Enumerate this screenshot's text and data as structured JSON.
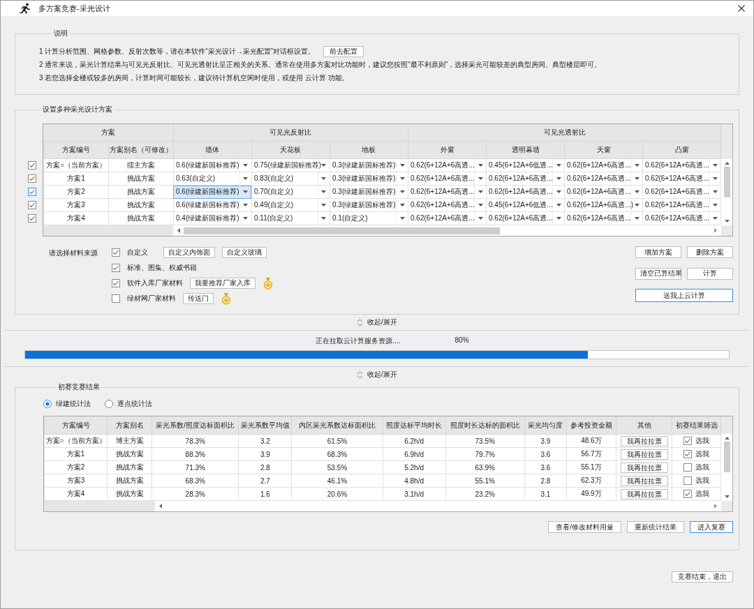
{
  "window": {
    "title": "多方案竞赛-采光设计"
  },
  "notes": {
    "title": "说明",
    "lines": [
      {
        "text": "1 计算分析范围、网格参数、反射次数等，请在本软件“采光设计→采光配置”对话框设置。",
        "button": "前去配置"
      },
      {
        "text": "2 通常来说，采光计算结果与可见光反射比、可见光透射比呈正相关的关系。通常在使用多方案对比功能时，建议您按照“最不利原则”，选择采光可能较差的典型房间、典型楼层即可。"
      },
      {
        "text": "3 若您选择全楼或较多的房间，计算时间可能较长，建议待计算机空闲时使用，或使用 云计算 功能。"
      }
    ]
  },
  "schemes": {
    "title": "设置多种采光设计方案",
    "groups": [
      {
        "label": "方案",
        "columns": [
          "方案编号",
          "方案别名（可修改）"
        ]
      },
      {
        "label": "可见光反射比",
        "columns": [
          "墙体",
          "天花板",
          "地板"
        ]
      },
      {
        "label": "可见光透射比",
        "columns": [
          "外窗",
          "透明幕墙",
          "天窗",
          "凸窗"
        ]
      }
    ],
    "rows": [
      {
        "checked": true,
        "selected": false,
        "number": "方案○（当前方案）",
        "alias": "擂主方案",
        "values": [
          "0.6(绿建新国标推荐)",
          "0.75(绿建新国标推荐)",
          "0.3(绿建新国标推荐)",
          "0.62(6+12A+6高透...",
          "0.45(6+12A+6低透...",
          "0.62(6+12A+6高透...",
          "0.62(6+12A+6高透..."
        ]
      },
      {
        "checked": true,
        "selected": false,
        "number": "方案1",
        "alias": "挑战方案",
        "values": [
          "0.63(自定义)",
          "0.83(自定义)",
          "0.3(绿建新国标推荐)",
          "0.62(6+12A+6高透...",
          "0.62(6+12A+6高透...",
          "0.62(6+12A+6高透...",
          "0.62(6+12A+6高透..."
        ]
      },
      {
        "checked": true,
        "selected": true,
        "number": "方案2",
        "alias": "挑战方案",
        "values": [
          "0.6(绿建新国标推荐)",
          "0.70(自定义)",
          "0.3(绿建新国标推荐)",
          "0.62(6+12A+6高透...",
          "0.62(6+12A+6高透...",
          "0.62(6+12A+6高透...",
          "0.62(6+12A+6高透..."
        ]
      },
      {
        "checked": true,
        "selected": false,
        "number": "方案3",
        "alias": "挑战方案",
        "values": [
          "0.6(绿建新国标推荐)",
          "0.49(自定义)",
          "0.3(绿建新国标推荐)",
          "0.62(6+12A+6高透...",
          "0.45(6+12A+6低透...",
          "0.62(6+12A+6高透...)",
          "0.62(6+12A+6高透..."
        ]
      },
      {
        "checked": true,
        "selected": false,
        "number": "方案4",
        "alias": "挑战方案",
        "values": [
          "0.4(绿建新国标推荐)",
          "0.11(自定义)",
          "0.1(自定义)",
          "0.62(6+12A+6高透...",
          "0.62(6+12A+6高透...",
          "0.62(6+12A+6高透...",
          "0.62(6+12A+6高透..."
        ]
      }
    ]
  },
  "materials": {
    "label": "请选择材料来源",
    "sources": [
      {
        "label": "自定义",
        "checked": true,
        "controls": [
          {
            "kind": "button",
            "label": "自定义内饰面"
          },
          {
            "kind": "button",
            "label": "自定义玻璃"
          }
        ]
      },
      {
        "label": "标准、图集、权威书籍",
        "checked": true
      },
      {
        "label": "软件入库厂家材料",
        "checked": true,
        "controls": [
          {
            "kind": "button",
            "label": "我要推荐厂家入库"
          },
          {
            "kind": "icon"
          }
        ]
      },
      {
        "label": "绿材网厂家材料",
        "checked": false,
        "controls": [
          {
            "kind": "button",
            "label": "传送门"
          },
          {
            "kind": "icon"
          }
        ]
      }
    ]
  },
  "actions": [
    {
      "label": "增加方案",
      "primary": false
    },
    {
      "label": "删除方案",
      "primary": false
    },
    {
      "label": "清空已算结果",
      "primary": false
    },
    {
      "label": "计算",
      "primary": false
    },
    {
      "label": "送我上云计算",
      "primary": true
    }
  ],
  "toggle_top": "收起/展开",
  "progress": {
    "label": "正在拉取云计算服务资源....",
    "percent": "80%",
    "level": 0.8
  },
  "toggle_bottom": "收起/展开",
  "results": {
    "title": "初赛竞赛结果",
    "methods": [
      {
        "label": "绿建统计法",
        "selected": true
      },
      {
        "label": "逐点统计法",
        "selected": false
      }
    ],
    "columns": [
      "方案编号",
      "方案别名",
      "采光系数/照度达标面积比",
      "采光系数平均值",
      "内区采光系数达标面积比",
      "照度达标平均时长",
      "照度时长达标的面积比",
      "采光均匀度",
      "参考投资金额",
      "其他",
      "初赛结果筛选"
    ],
    "rows": [
      {
        "number": "方案○（当前方案）",
        "alias": "博主方案",
        "values": [
          "78.3%",
          "3.2",
          "61.5%",
          "6.2h/d",
          "73.5%",
          "3.9",
          "48.6万"
        ],
        "vote_button": "我再拉拉票",
        "pick": {
          "label": "选我",
          "checked": true
        }
      },
      {
        "number": "方案1",
        "alias": "挑战方案",
        "values": [
          "88.3%",
          "3.9",
          "68.3%",
          "6.9h/d",
          "79.7%",
          "3.6",
          "56.7万"
        ],
        "vote_button": "我再拉拉票",
        "pick": {
          "label": "选我",
          "checked": true
        }
      },
      {
        "number": "方案2",
        "alias": "挑战方案",
        "values": [
          "71.3%",
          "2.8",
          "53.5%",
          "5.2h/d",
          "63.9%",
          "3.6",
          "55.1万"
        ],
        "vote_button": "我再拉拉票",
        "pick": {
          "label": "选我",
          "checked": false
        }
      },
      {
        "number": "方案3",
        "alias": "挑战方案",
        "values": [
          "68.3%",
          "2.7",
          "46.1%",
          "4.8h/d",
          "55.1%",
          "2.8",
          "62.3万"
        ],
        "vote_button": "我再拉拉票",
        "pick": {
          "label": "选我",
          "checked": false
        }
      },
      {
        "number": "方案4",
        "alias": "挑战方案",
        "values": [
          "28.3%",
          "1.6",
          "20.6%",
          "3.1h/d",
          "23.2%",
          "3.1",
          "49.9万"
        ],
        "vote_button": "我再拉拉票",
        "pick": {
          "label": "选我",
          "checked": true
        }
      }
    ],
    "buttons": [
      {
        "label": "查看/修改材料用量",
        "primary": false
      },
      {
        "label": "重新统计结果",
        "primary": false
      },
      {
        "label": "进入复赛",
        "primary": true
      }
    ]
  },
  "footer_button": "竞赛结束，退出"
}
